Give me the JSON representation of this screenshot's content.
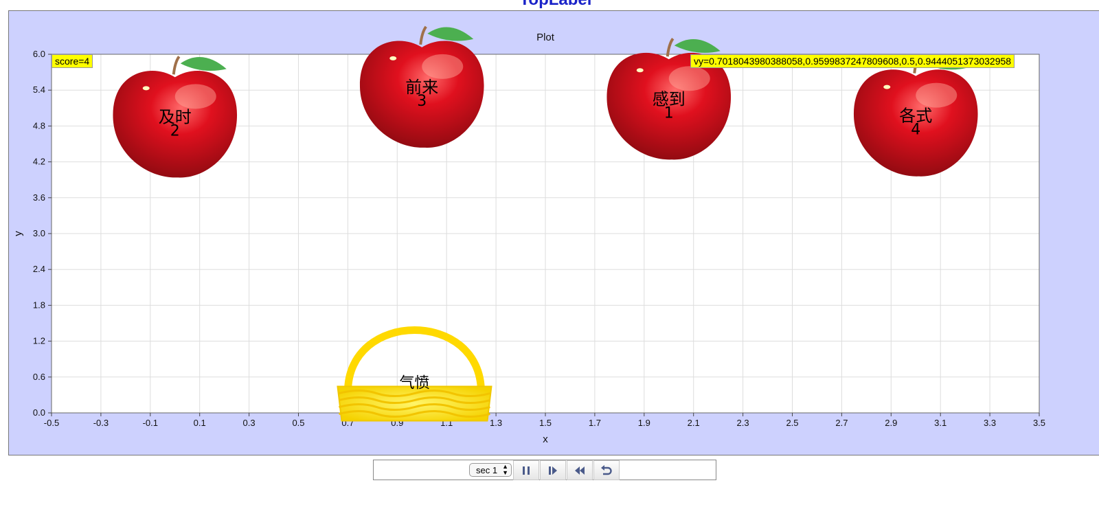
{
  "window": {
    "title": "TopLabel"
  },
  "plot": {
    "title": "Plot",
    "score_text": "score=4",
    "vy_text": "vy=0.7018043980388058,0.9599837247809608,0.5,0.9444051373032958",
    "colors": {
      "panel": "#cdd1fe",
      "grid": "#dddddd",
      "readout_bg": "#ffff00",
      "title": "#1a23c8"
    }
  },
  "chart_data": {
    "type": "scatter",
    "title": "Plot",
    "xlabel": "x",
    "ylabel": "y",
    "xlim": [
      -0.5,
      3.5
    ],
    "ylim": [
      0.0,
      6.0
    ],
    "xticks": [
      "-0.5",
      "-0.3",
      "-0.1",
      "0.1",
      "0.3",
      "0.5",
      "0.7",
      "0.9",
      "1.1",
      "1.3",
      "1.5",
      "1.7",
      "1.9",
      "2.1",
      "2.3",
      "2.5",
      "2.7",
      "2.9",
      "3.1",
      "3.3",
      "3.5"
    ],
    "yticks": [
      "0.0",
      "0.6",
      "1.2",
      "1.8",
      "2.4",
      "3.0",
      "3.6",
      "4.2",
      "4.8",
      "5.4",
      "6.0"
    ],
    "grid": true,
    "apples": [
      {
        "x": 0.0,
        "y": 4.95,
        "word": "及时",
        "number": "2"
      },
      {
        "x": 1.0,
        "y": 5.45,
        "word": "前来",
        "number": "3"
      },
      {
        "x": 2.0,
        "y": 5.25,
        "word": "感到",
        "number": "1"
      },
      {
        "x": 3.0,
        "y": 4.97,
        "word": "各式",
        "number": "4"
      }
    ],
    "basket": {
      "x": 0.97,
      "y": 0.35,
      "word": "气愤"
    }
  },
  "controls": {
    "section_select": "sec 1",
    "buttons": [
      "pause",
      "step-forward",
      "rewind",
      "reset"
    ]
  }
}
